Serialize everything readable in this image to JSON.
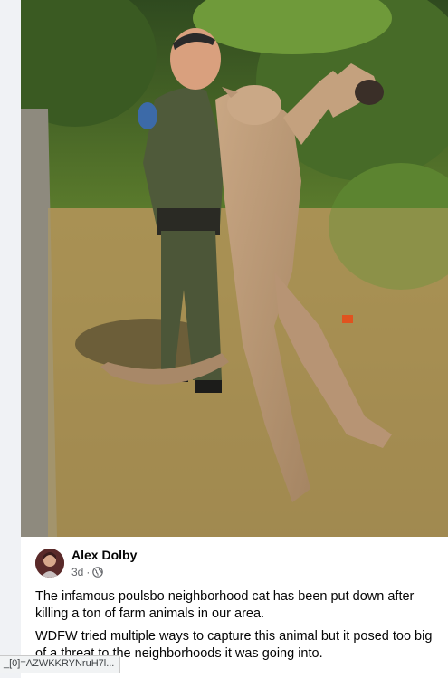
{
  "post": {
    "author": "Alex Dolby",
    "time": "3d",
    "separator": "·",
    "privacy_icon": "globe-icon",
    "paragraphs": [
      "The infamous poulsbo neighborhood cat has been put down after killing a ton of farm animals in our area.",
      "WDFW tried multiple ways to capture this animal but it posed too big of a threat to the neighborhoods it was going into."
    ],
    "photo_icon": "officer-holding-cougar-photo"
  },
  "status_bar": {
    "url": "_[0]=AZWKKRYNruH7l..."
  },
  "colors": {
    "card_bg": "#ffffff",
    "page_bg": "#f0f2f5",
    "secondary_text": "#65676b"
  }
}
